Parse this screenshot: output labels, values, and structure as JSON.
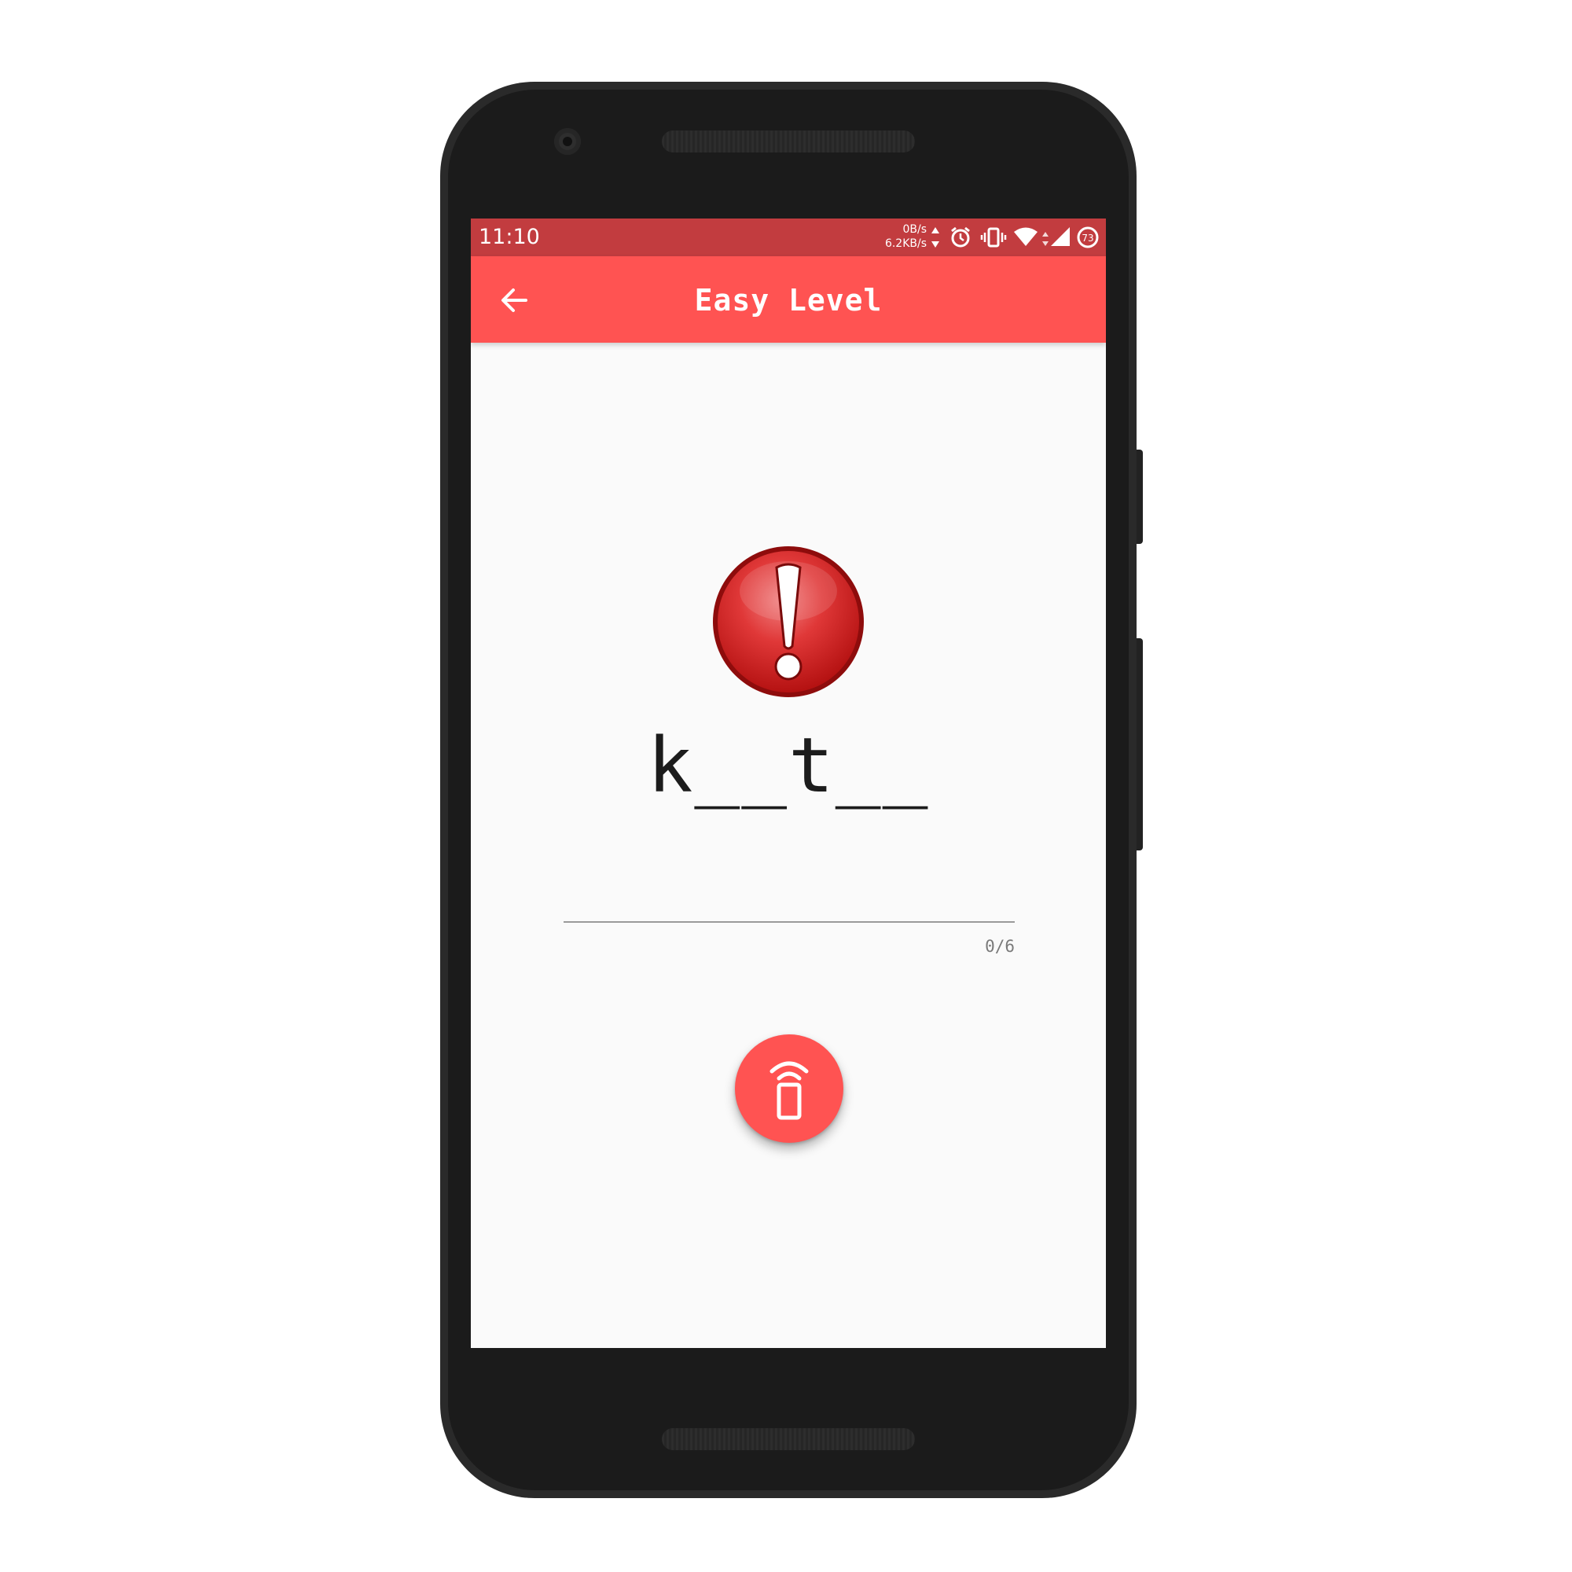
{
  "status_bar": {
    "time": "11:10",
    "upload_speed": "0B/s",
    "download_speed": "6.2KB/s",
    "battery_level": "73",
    "icons": [
      "data-arrows-icon",
      "alarm-icon",
      "vibrate-icon",
      "wifi-icon",
      "cell-signal-icon",
      "battery-icon"
    ]
  },
  "app_bar": {
    "title": "Easy Level",
    "back_icon": "arrow-left-icon"
  },
  "game": {
    "status_icon": "exclamation-alert-icon",
    "puzzle_word": "k__t__",
    "answer_value": "",
    "char_counter": "0/6"
  },
  "fab": {
    "icon": "phone-signal-icon"
  },
  "colors": {
    "status_bar": "#c23c3f",
    "app_bar": "#ff5352",
    "fab": "#ff5352",
    "background": "#fafafa",
    "phone_body": "#1b1b1b"
  }
}
